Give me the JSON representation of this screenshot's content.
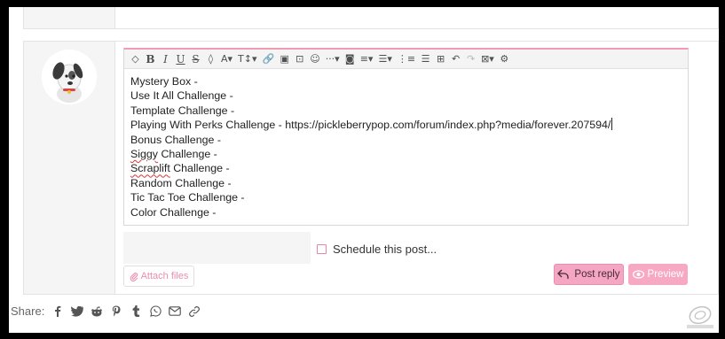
{
  "editor": {
    "lines": [
      {
        "pre": "Mystery Box -",
        "spell": "",
        "post": ""
      },
      {
        "pre": "Use It All Challenge -",
        "spell": "",
        "post": ""
      },
      {
        "pre": "Template Challenge -",
        "spell": "",
        "post": ""
      },
      {
        "pre": "Playing With Perks Challenge - https://pickleberrypop.com/forum/index.php?media/forever.207594/",
        "spell": "",
        "post": ""
      },
      {
        "pre": "Bonus Challenge -",
        "spell": "",
        "post": ""
      },
      {
        "pre": "",
        "spell": "Siggy",
        "post": " Challenge -"
      },
      {
        "pre": "",
        "spell": "Scraplift",
        "post": " Challenge -"
      },
      {
        "pre": "Random Challenge -",
        "spell": "",
        "post": ""
      },
      {
        "pre": "Tic Tac Toe Challenge -",
        "spell": "",
        "post": ""
      },
      {
        "pre": "Color Challenge -",
        "spell": "",
        "post": ""
      }
    ],
    "toolbar": [
      {
        "name": "eraser-icon",
        "glyph": "◇",
        "sans": true
      },
      {
        "name": "bold-button",
        "glyph": "B"
      },
      {
        "name": "italic-button",
        "glyph": "I"
      },
      {
        "name": "underline-button",
        "glyph": "U"
      },
      {
        "name": "strikethrough-button",
        "glyph": "S"
      },
      {
        "name": "text-color-icon",
        "glyph": "◊",
        "sans": true
      },
      {
        "name": "font-family-dropdown",
        "glyph": "A▾",
        "sans": true
      },
      {
        "name": "font-size-dropdown",
        "glyph": "T↕▾",
        "sans": true
      },
      {
        "name": "link-icon",
        "glyph": "🔗",
        "sans": true
      },
      {
        "name": "image-icon",
        "glyph": "▣",
        "sans": true
      },
      {
        "name": "media-icon",
        "glyph": "⊡",
        "sans": true
      },
      {
        "name": "emoji-icon",
        "glyph": "☺",
        "sans": true
      },
      {
        "name": "more-options-dropdown",
        "glyph": "···▾",
        "sans": true
      },
      {
        "name": "camera-icon",
        "glyph": "◙",
        "sans": true
      },
      {
        "name": "align-dropdown",
        "glyph": "≡▾",
        "sans": true
      },
      {
        "name": "list-dropdown",
        "glyph": "☰▾",
        "sans": true
      },
      {
        "name": "ordered-list-icon",
        "glyph": "⋮≡",
        "sans": true
      },
      {
        "name": "bullet-list-icon",
        "glyph": "☰",
        "sans": true
      },
      {
        "name": "table-icon",
        "glyph": "⊞",
        "sans": true
      },
      {
        "name": "undo-icon",
        "glyph": "↶",
        "sans": true
      },
      {
        "name": "redo-icon",
        "glyph": "↷",
        "sans": true,
        "dim": true
      },
      {
        "name": "template-dropdown",
        "glyph": "⊠▾",
        "sans": true
      },
      {
        "name": "settings-icon",
        "glyph": "⚙",
        "sans": true
      }
    ]
  },
  "schedule_label": "Schedule this post...",
  "attach_label": "Attach files",
  "post_reply_label": "Post reply",
  "preview_label": "Preview",
  "share_label": "Share:",
  "share_icons": [
    "facebook-icon",
    "twitter-icon",
    "reddit-icon",
    "pinterest-icon",
    "tumblr-icon",
    "whatsapp-icon",
    "email-icon",
    "link-icon"
  ],
  "colors": {
    "accent": "#f4a6c3",
    "accent_text": "#ec8db0"
  }
}
